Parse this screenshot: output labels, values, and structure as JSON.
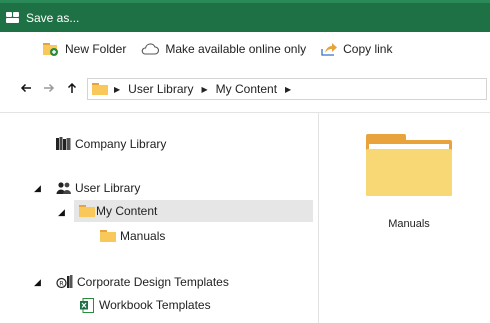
{
  "window": {
    "title": "Save as...",
    "accent": "#1e7145"
  },
  "toolbar": {
    "new_folder": "New Folder",
    "make_online": "Make available online only",
    "copy_link": "Copy link"
  },
  "nav": {
    "back_icon": "arrow-left-icon",
    "forward_icon": "arrow-right-icon",
    "up_icon": "arrow-up-icon",
    "breadcrumb": [
      "User Library",
      "My Content"
    ]
  },
  "tree": {
    "company_library": "Company Library",
    "user_library": "User Library",
    "my_content": "My Content",
    "manuals": "Manuals",
    "corporate_templates": "Corporate Design Templates",
    "workbook_templates": "Workbook Templates"
  },
  "content": {
    "items": [
      {
        "name": "Manuals",
        "type": "folder"
      }
    ]
  }
}
